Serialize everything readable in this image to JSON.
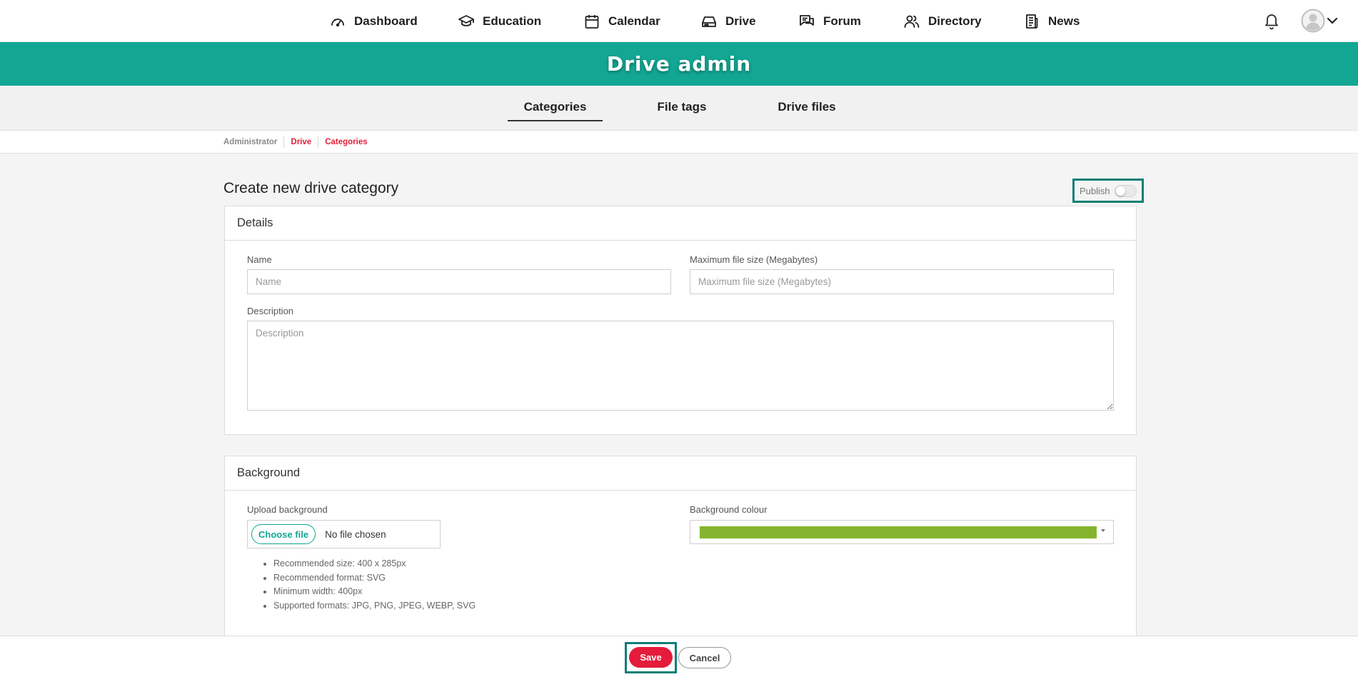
{
  "nav": {
    "items": [
      {
        "label": "Dashboard",
        "icon": "gauge-icon"
      },
      {
        "label": "Education",
        "icon": "graduation-cap-icon"
      },
      {
        "label": "Calendar",
        "icon": "calendar-icon"
      },
      {
        "label": "Drive",
        "icon": "hard-drive-icon"
      },
      {
        "label": "Forum",
        "icon": "chat-bubbles-icon"
      },
      {
        "label": "Directory",
        "icon": "users-icon"
      },
      {
        "label": "News",
        "icon": "newspaper-icon"
      }
    ],
    "notifications_icon": "bell-icon",
    "user_icon": "avatar-icon"
  },
  "banner": {
    "title": "Drive admin",
    "color": "#12a693"
  },
  "subnav": {
    "tabs": [
      {
        "label": "Categories",
        "active": true
      },
      {
        "label": "File tags",
        "active": false
      },
      {
        "label": "Drive files",
        "active": false
      }
    ]
  },
  "breadcrumb": [
    "Administrator",
    "Drive",
    "Categories"
  ],
  "page": {
    "title": "Create new drive category",
    "publish_label": "Publish",
    "publish_on": false
  },
  "details": {
    "heading": "Details",
    "name_label": "Name",
    "name_placeholder": "Name",
    "max_size_label": "Maximum file size (Megabytes)",
    "max_size_placeholder": "Maximum file size (Megabytes)",
    "description_label": "Description",
    "description_placeholder": "Description"
  },
  "background": {
    "heading": "Background",
    "upload_label": "Upload background",
    "choose_file": "Choose file",
    "no_file": "No file chosen",
    "hints": [
      "Recommended size: 400 x 285px",
      "Recommended format: SVG",
      "Minimum width: 400px",
      "Supported formats: JPG, PNG, JPEG, WEBP, SVG"
    ],
    "colour_label": "Background colour",
    "colour_value": "#84b42d"
  },
  "footer": {
    "save": "Save",
    "cancel": "Cancel"
  },
  "colors": {
    "accent": "#12a693",
    "danger": "#e41b3a",
    "focus_outline": "#0d7f76"
  }
}
